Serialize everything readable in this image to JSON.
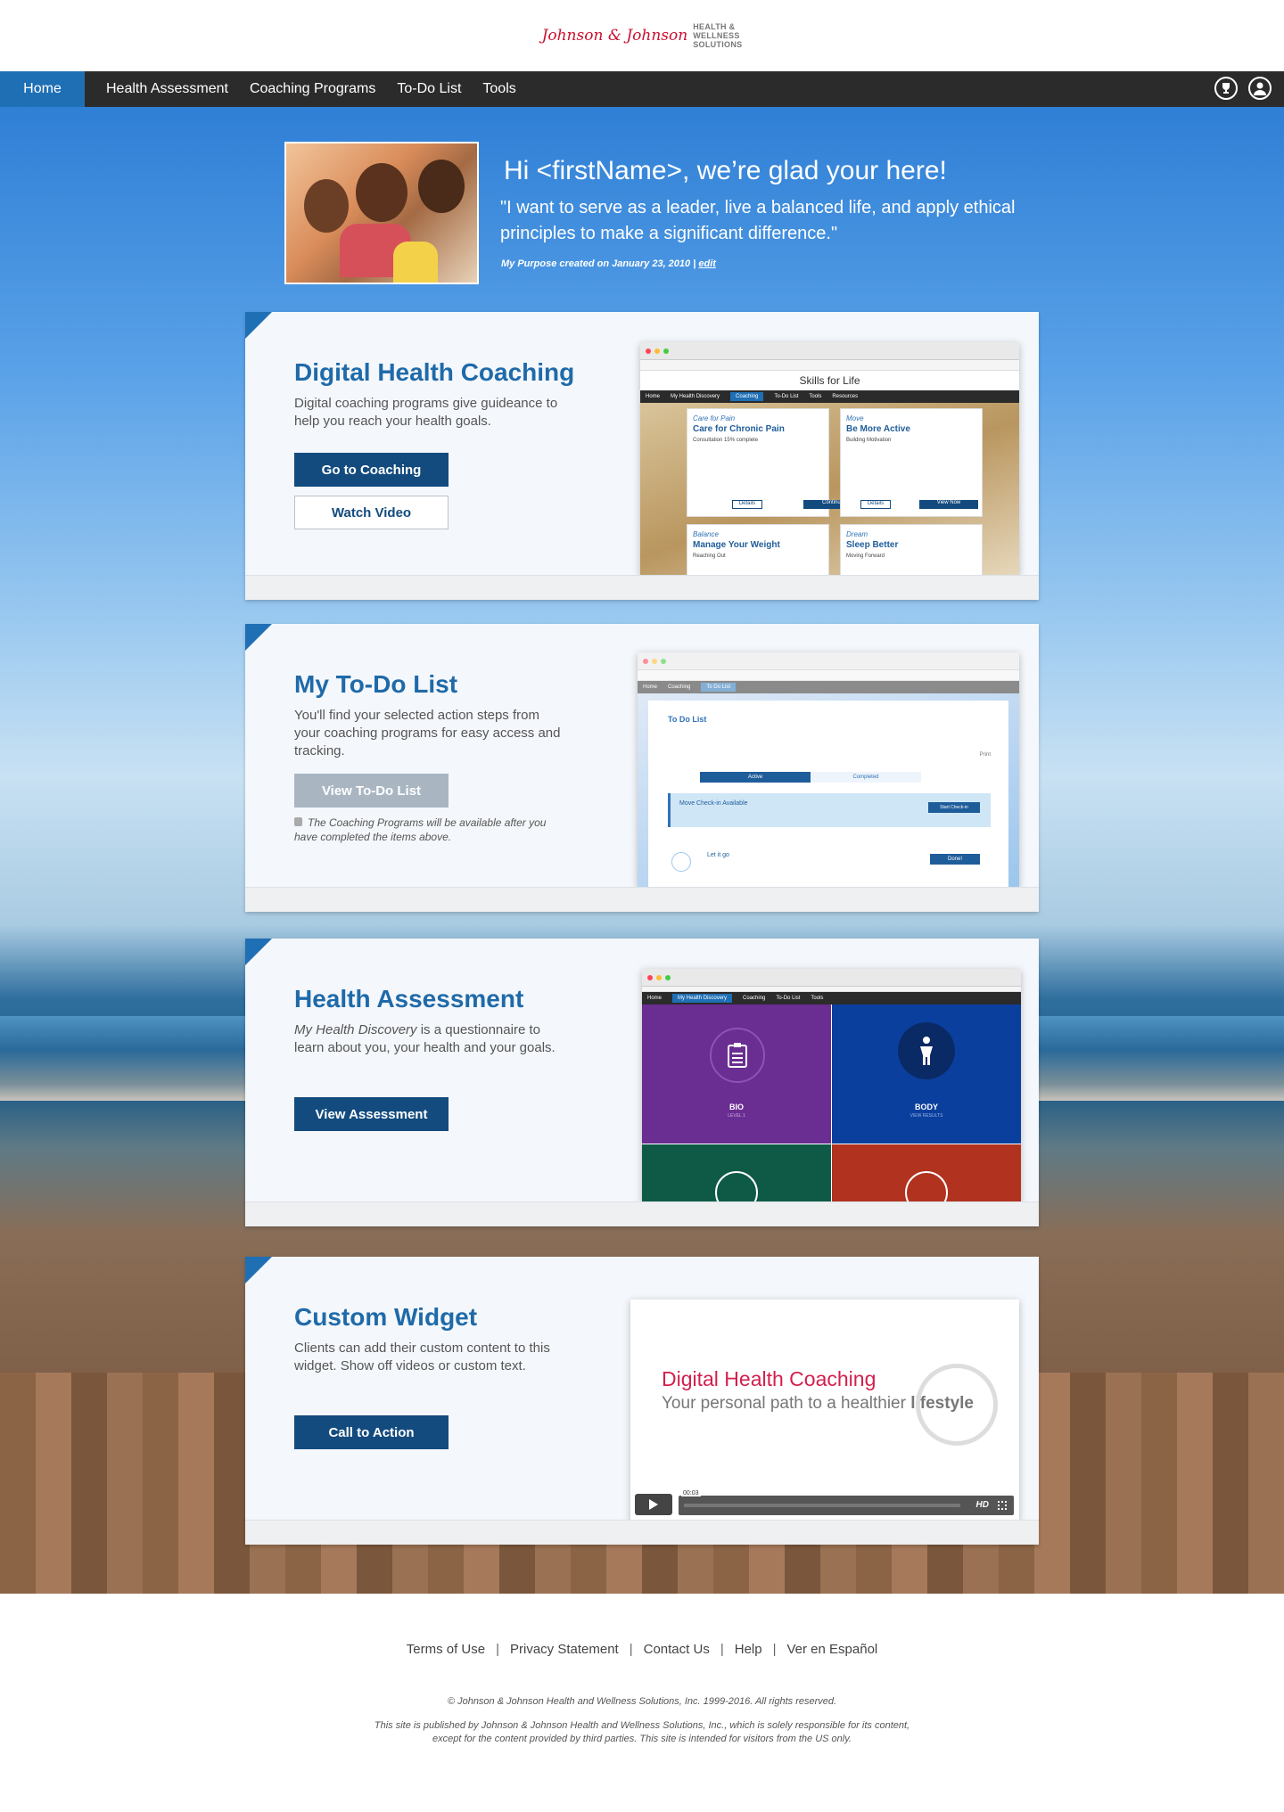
{
  "header": {
    "logo_script": "Johnson & Johnson",
    "logo_sub": [
      "HEALTH &",
      "WELLNESS",
      "SOLUTIONS"
    ]
  },
  "nav": {
    "items": [
      "Home",
      "Health Assessment",
      "Coaching Programs",
      "To-Do List",
      "Tools"
    ],
    "active": "Home"
  },
  "hero": {
    "greeting": "Hi <firstName>, we’re glad your here!",
    "quote": "\"I want to serve as a leader, live a balanced life, and apply ethical principles to make a significant difference.\"",
    "meta": "My Purpose created on January 23, 2010 |",
    "edit": "edit"
  },
  "cards": [
    {
      "title": "Digital Health Coaching",
      "desc": "Digital coaching programs give guideance to help you reach your health goals.",
      "btn1": "Go to Coaching",
      "btn2": "Watch Video",
      "shot": {
        "brand": "Skills for Life",
        "nav": [
          "Home",
          "My Health Discovery",
          "Coaching",
          "To-Do List",
          "Tools",
          "Resources"
        ],
        "tiles": [
          {
            "cat": "Care for Pain",
            "name": "Care for Chronic Pain",
            "note": "Consultation 15% complete",
            "b1": "Details",
            "b2": "Continue"
          },
          {
            "cat": "Move",
            "name": "Be More Active",
            "note": "Building Motivation",
            "b1": "Details",
            "b2": "View Now"
          },
          {
            "cat": "Balance",
            "name": "Manage Your Weight",
            "note": "Reaching Out"
          },
          {
            "cat": "Dream",
            "name": "Sleep Better",
            "note": "Moving Forward"
          }
        ]
      }
    },
    {
      "title": "My To-Do List",
      "desc": "You'll find your selected action steps from your coaching programs for easy access and tracking.",
      "btn1": "View To-Do List",
      "lock": "The Coaching Programs will be available after you have completed the items above.",
      "shot": {
        "heading": "To Do List",
        "tabs": [
          "Active",
          "Completed"
        ],
        "banner": "Move Check-in Available",
        "banner_btn": "Start Check-in",
        "item": "Let it go",
        "item_btn": "Done!",
        "print": "Print"
      }
    },
    {
      "title": "Health Assessment",
      "desc_em": "My Health Discovery",
      "desc": " is a questionnaire to learn about you, your health and your goals.",
      "btn1": "View Assessment",
      "shot": {
        "tiles": [
          {
            "label": "BIO",
            "sub": "LEVEL 1",
            "color": "#6a2d91"
          },
          {
            "label": "BODY",
            "sub": "VIEW RESULTS",
            "color": "#0b3f9e"
          },
          {
            "label": "",
            "sub": "",
            "color": "#0e5a46"
          },
          {
            "label": "",
            "sub": "",
            "color": "#b0321f"
          }
        ]
      }
    },
    {
      "title": "Custom Widget",
      "desc": "Clients can add their custom content to this widget.  Show off videos or custom text.",
      "btn1": "Call to Action",
      "video": {
        "title": "Digital Health Coaching",
        "tagline": "Your personal path to a healthier",
        "tagline_em": "lifestyle",
        "time": "00:03",
        "hd": "HD"
      }
    }
  ],
  "footer": {
    "links": [
      "Terms of Use",
      "Privacy Statement",
      "Contact Us",
      "Help",
      "Ver en Español"
    ],
    "copyright": "© Johnson & Johnson Health and Wellness Solutions, Inc. 1999-2016. All rights reserved.",
    "disclaimer": "This site is published by Johnson & Johnson Health and Wellness Solutions, Inc., which is solely responsible for its content, except for the content provided by third parties.  This site is intended for visitors from the US only."
  },
  "colors": {
    "brand_red": "#c8102e",
    "nav_bg": "#2b2b2b",
    "accent_blue": "#1f6fb5",
    "button_navy": "#134b7e",
    "title_blue": "#1f6aa9"
  }
}
